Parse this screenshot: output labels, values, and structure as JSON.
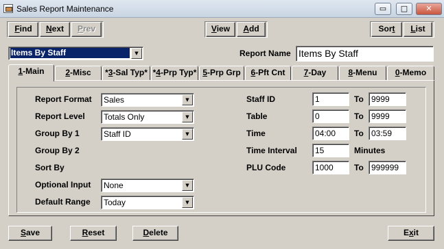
{
  "window": {
    "title": "Sales Report Maintenance",
    "minimize": "▭",
    "maximize": "□",
    "close": "✕"
  },
  "toolbar": {
    "find": {
      "u": "F",
      "rest": "ind"
    },
    "next": {
      "u": "N",
      "rest": "ext"
    },
    "prev": {
      "u": "P",
      "rest": "rev"
    },
    "view": {
      "u": "V",
      "rest": "iew"
    },
    "add": {
      "u": "A",
      "rest": "dd"
    },
    "sort": {
      "pre": "Sor",
      "u": "t"
    },
    "list": {
      "u": "L",
      "rest": "ist"
    }
  },
  "report_select": {
    "value": "Items By Staff"
  },
  "report_name": {
    "label": "Report Name",
    "value": "Items By Staff"
  },
  "tabs": [
    {
      "pre": "",
      "u": "1",
      "rest": "-Main"
    },
    {
      "pre": "",
      "u": "2",
      "rest": "-Misc"
    },
    {
      "pre": "*",
      "u": "3",
      "rest": "-Sal Typ*"
    },
    {
      "pre": "*",
      "u": "4",
      "rest": "-Prp Typ*"
    },
    {
      "pre": "",
      "u": "5",
      "rest": "-Prp Grp"
    },
    {
      "pre": "",
      "u": "6",
      "rest": "-Pft Cnt"
    },
    {
      "pre": "",
      "u": "7",
      "rest": "-Day"
    },
    {
      "pre": "",
      "u": "8",
      "rest": "-Menu"
    },
    {
      "pre": "",
      "u": "0",
      "rest": "-Memo"
    }
  ],
  "left": {
    "report_format": {
      "label": "Report Format",
      "value": "Sales"
    },
    "report_level": {
      "label": "Report Level",
      "value": "Totals Only"
    },
    "group_by_1": {
      "label": "Group By 1",
      "value": "Staff ID"
    },
    "group_by_2": {
      "label": "Group By 2"
    },
    "sort_by": {
      "label": "Sort By"
    },
    "optional_input": {
      "label": "Optional Input",
      "value": "None"
    },
    "default_range": {
      "label": "Default Range",
      "value": "Today"
    }
  },
  "right": {
    "to_label": "To",
    "staff_id": {
      "label": "Staff ID",
      "from": "1",
      "to": "9999"
    },
    "table": {
      "label": "Table",
      "from": "0",
      "to": "9999"
    },
    "time": {
      "label": "Time",
      "from": "04:00",
      "to": "03:59"
    },
    "time_interval": {
      "label": "Time Interval",
      "value": "15",
      "unit": "Minutes"
    },
    "plu_code": {
      "label": "PLU Code",
      "from": "1000",
      "to": "999999"
    }
  },
  "bottom": {
    "save": {
      "u": "S",
      "rest": "ave"
    },
    "reset": {
      "u": "R",
      "rest": "eset"
    },
    "delete": {
      "u": "D",
      "rest": "elete"
    },
    "exit": {
      "pre": "E",
      "u": "x",
      "rest": "it"
    }
  }
}
